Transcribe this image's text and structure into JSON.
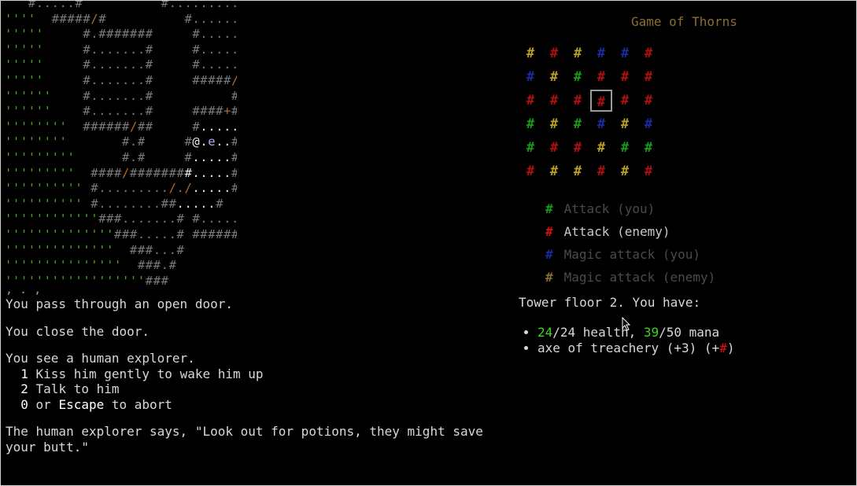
{
  "game_title": "Game of Thorns",
  "grid": [
    [
      "#b8a028",
      "#b01010",
      "#b8a028",
      "#1a2aa0",
      "#1a2aa0",
      "#b01010"
    ],
    [
      "#1a2aa0",
      "#b8a028",
      "#1a9a1a",
      "#b01010",
      "#b01010",
      "#b01010"
    ],
    [
      "#b01010",
      "#b01010",
      "#b01010",
      "#b01010",
      "#b01010",
      "#b01010"
    ],
    [
      "#1a9a1a",
      "#b8a028",
      "#1a9a1a",
      "#1a2aa0",
      "#b8a028",
      "#1a2aa0"
    ],
    [
      "#1a9a1a",
      "#b01010",
      "#b01010",
      "#b8a028",
      "#1a9a1a",
      "#1a9a1a"
    ],
    [
      "#b01010",
      "#b8a028",
      "#b8a028",
      "#b01010",
      "#b8a028",
      "#b01010"
    ]
  ],
  "grid_symbol": "#",
  "selected_cell": [
    2,
    3
  ],
  "legend": [
    {
      "symbol": "#",
      "symbol_color": "#1a9a1a",
      "label": "Attack (you)",
      "label_color": "#4a4a4a"
    },
    {
      "symbol": "#",
      "symbol_color": "#d01010",
      "label": "Attack (enemy)",
      "label_color": "#c8c8c8"
    },
    {
      "symbol": "#",
      "symbol_color": "#1a2aa0",
      "label": "Magic attack (you)",
      "label_color": "#4a4a4a"
    },
    {
      "symbol": "#",
      "symbol_color": "#8a6f2a",
      "label": "Magic attack (enemy)",
      "label_color": "#4a4a4a"
    }
  ],
  "status": {
    "header": "Tower floor 2. You have:",
    "health_cur": "24",
    "health_rest": "/24 health, ",
    "mana_cur": "39",
    "mana_rest": "/50 mana",
    "item_text": "axe of treachery (+3) (+",
    "item_symbol": "#",
    "item_close": ")"
  },
  "log": {
    "cut_line": "  ,    .     ,",
    "line1": "You pass through an open door.",
    "line2": "You close the door.",
    "line3": "You see a human explorer.",
    "options": [
      {
        "key": "1",
        "text": " Kiss him gently to wake him up"
      },
      {
        "key": "2",
        "text": " Talk to him"
      },
      {
        "key": "0",
        "text": " or ",
        "key2": "Escape",
        "text2": " to abort"
      }
    ],
    "line4": "The human explorer says, \"Look out for potions, they might save\nyour butt.\""
  },
  "map_rows": [
    [
      [
        "w",
        "   #.....#"
      ],
      [
        "n",
        "          "
      ],
      [
        "w",
        "#..........####.......#####"
      ]
    ],
    [
      [
        "g",
        "''''"
      ],
      [
        "w",
        "  #####"
      ],
      [
        "d",
        "/"
      ],
      [
        "w",
        "#"
      ],
      [
        "n",
        "          "
      ],
      [
        "w",
        "#............"
      ],
      [
        "d",
        "/"
      ],
      [
        "w",
        "......#"
      ]
    ],
    [
      [
        "g",
        "'''''"
      ],
      [
        "w",
        "     #.#######     #..........#.######"
      ],
      [
        "d",
        "+"
      ],
      [
        "w",
        "#"
      ]
    ],
    [
      [
        "g",
        "'''''"
      ],
      [
        "w",
        "     #.......#     #.........# #."
      ]
    ],
    [
      [
        "g",
        "'''''"
      ],
      [
        "w",
        "     #.......#     #.........# #."
      ]
    ],
    [
      [
        "g",
        "'''''"
      ],
      [
        "w",
        "     #.......#     #####"
      ],
      [
        "d",
        "/"
      ],
      [
        "w",
        "##### #."
      ]
    ],
    [
      [
        "g",
        "''''''"
      ],
      [
        "w",
        "    #.......#          #.#"
      ]
    ],
    [
      [
        "g",
        "''''''"
      ],
      [
        "w",
        "    #.......#     ####"
      ],
      [
        "d",
        "+"
      ],
      [
        "w",
        "##"
      ]
    ],
    [
      [
        "g",
        "''''''''"
      ],
      [
        "w",
        "  ######"
      ],
      [
        "d",
        "/"
      ],
      [
        "w",
        "##     #"
      ],
      [
        "p",
        "....."
      ],
      [
        "w",
        "#"
      ]
    ],
    [
      [
        "g",
        "''''''''"
      ],
      [
        "w",
        "       #.#     #"
      ],
      [
        "a",
        "@"
      ],
      [
        "p",
        "."
      ],
      [
        "e",
        "e"
      ],
      [
        "p",
        ".."
      ],
      [
        "w",
        "#"
      ]
    ],
    [
      [
        "g",
        "'''''''''"
      ],
      [
        "w",
        "      #.#     #"
      ],
      [
        "p",
        "....."
      ],
      [
        "w",
        "#"
      ]
    ],
    [
      [
        "g",
        "'''''''''"
      ],
      [
        "w",
        "  ####"
      ],
      [
        "d",
        "/"
      ],
      [
        "w",
        "#######"
      ],
      [
        "p",
        "#....."
      ],
      [
        "w",
        "#"
      ]
    ],
    [
      [
        "g",
        "''''''''''"
      ],
      [
        "w",
        " #........."
      ],
      [
        "d",
        "/"
      ],
      [
        "w",
        "."
      ],
      [
        "d",
        "/"
      ],
      [
        "p",
        "....."
      ],
      [
        "w",
        "#"
      ]
    ],
    [
      [
        "g",
        "''''''''''"
      ],
      [
        "w",
        " #........##"
      ],
      [
        "p",
        "....."
      ],
      [
        "w",
        "#"
      ]
    ],
    [
      [
        "g",
        "''''''''''''"
      ],
      [
        "w",
        "###.......# #.....#"
      ]
    ],
    [
      [
        "g",
        "''''''''''''''"
      ],
      [
        "w",
        "###.....# #######"
      ]
    ],
    [
      [
        "g",
        "''''''''''''''"
      ],
      [
        "w",
        "  ###...#"
      ]
    ],
    [
      [
        "g",
        "'''''''''''''''"
      ],
      [
        "w",
        "  ###.#"
      ]
    ],
    [
      [
        "g",
        "''''''''''''''''''"
      ],
      [
        "w",
        "###"
      ]
    ]
  ]
}
